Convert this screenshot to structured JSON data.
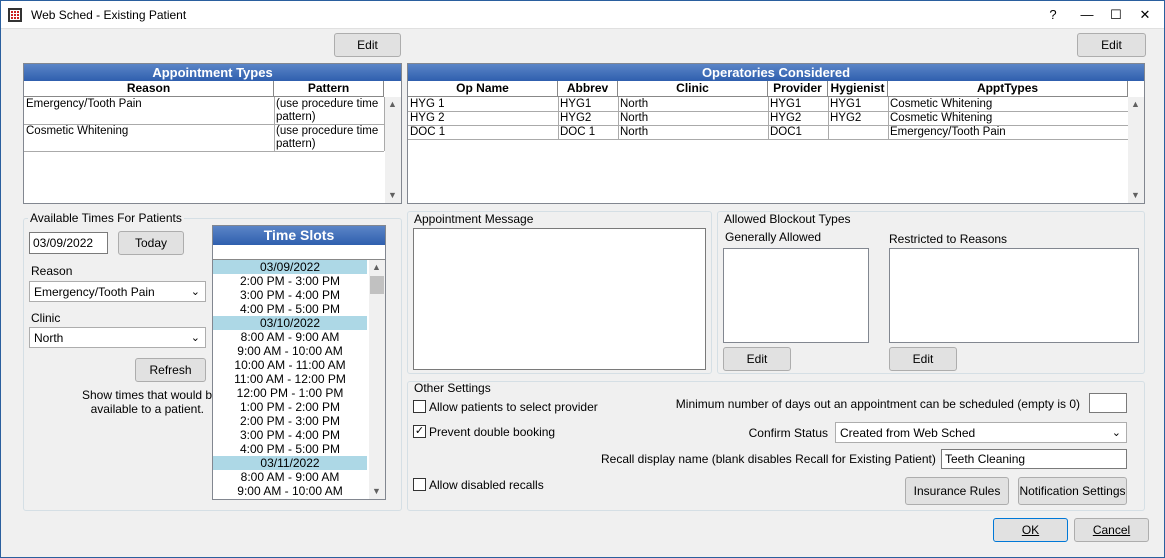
{
  "window": {
    "title": "Web Sched - Existing Patient",
    "help": "?",
    "minimize": "—",
    "maximize": "☐",
    "close": "✕"
  },
  "top_buttons": {
    "edit_left": "Edit",
    "edit_right": "Edit"
  },
  "appt_types": {
    "title": "Appointment Types",
    "columns": [
      "Reason",
      "Pattern"
    ],
    "rows": [
      {
        "reason": "Emergency/Tooth Pain",
        "pattern_line1": "(use procedure time",
        "pattern_line2": "pattern)"
      },
      {
        "reason": "Cosmetic Whitening",
        "pattern_line1": "(use procedure time",
        "pattern_line2": "pattern)"
      }
    ]
  },
  "operatories": {
    "title": "Operatories Considered",
    "columns": [
      "Op Name",
      "Abbrev",
      "Clinic",
      "Provider",
      "Hygienist",
      "ApptTypes"
    ],
    "rows": [
      [
        "HYG 1",
        "HYG1",
        "North",
        "HYG1",
        "HYG1",
        "Cosmetic Whitening"
      ],
      [
        "HYG 2",
        "HYG2",
        "North",
        "HYG2",
        "HYG2",
        "Cosmetic Whitening"
      ],
      [
        "DOC 1",
        "DOC 1",
        "North",
        "DOC1",
        "",
        "Emergency/Tooth Pain"
      ]
    ]
  },
  "available_times": {
    "group_label": "Available Times For Patients",
    "date_value": "03/09/2022",
    "today_label": "Today",
    "reason_label": "Reason",
    "reason_value": "Emergency/Tooth Pain",
    "clinic_label": "Clinic",
    "clinic_value": "North",
    "refresh_label": "Refresh",
    "note_line1": "Show times that would be",
    "note_line2": "available to a patient."
  },
  "time_slots": {
    "title": "Time Slots",
    "items": [
      {
        "text": "03/09/2022",
        "date": true
      },
      {
        "text": "2:00 PM - 3:00 PM",
        "date": false
      },
      {
        "text": "3:00 PM - 4:00 PM",
        "date": false
      },
      {
        "text": "4:00 PM - 5:00 PM",
        "date": false
      },
      {
        "text": "03/10/2022",
        "date": true
      },
      {
        "text": "8:00 AM - 9:00 AM",
        "date": false
      },
      {
        "text": "9:00 AM - 10:00 AM",
        "date": false
      },
      {
        "text": "10:00 AM - 11:00 AM",
        "date": false
      },
      {
        "text": "11:00 AM - 12:00 PM",
        "date": false
      },
      {
        "text": "12:00 PM - 1:00 PM",
        "date": false
      },
      {
        "text": "1:00 PM - 2:00 PM",
        "date": false
      },
      {
        "text": "2:00 PM - 3:00 PM",
        "date": false
      },
      {
        "text": "3:00 PM - 4:00 PM",
        "date": false
      },
      {
        "text": "4:00 PM - 5:00 PM",
        "date": false
      },
      {
        "text": "03/11/2022",
        "date": true
      },
      {
        "text": "8:00 AM - 9:00 AM",
        "date": false
      },
      {
        "text": "9:00 AM - 10:00 AM",
        "date": false
      }
    ]
  },
  "appointment_message": {
    "label": "Appointment Message",
    "value": ""
  },
  "blockouts": {
    "label": "Allowed Blockout Types",
    "generally_label": "Generally Allowed",
    "restricted_label": "Restricted to Reasons",
    "edit_left": "Edit",
    "edit_right": "Edit"
  },
  "other_settings": {
    "label": "Other Settings",
    "allow_provider_label": "Allow patients to select provider",
    "allow_provider_checked": false,
    "prevent_double_label": "Prevent double booking",
    "prevent_double_checked": true,
    "allow_disabled_label": "Allow disabled recalls",
    "allow_disabled_checked": false,
    "min_days_label": "Minimum number of days out an appointment can be scheduled (empty is 0)",
    "min_days_value": "",
    "confirm_label": "Confirm Status",
    "confirm_value": "Created from Web Sched",
    "recall_label": "Recall display name (blank disables Recall for Existing Patient)",
    "recall_value": "Teeth Cleaning",
    "insurance_rules": "Insurance Rules",
    "notification_settings": "Notification Settings"
  },
  "footer": {
    "ok": "OK",
    "cancel": "Cancel"
  }
}
